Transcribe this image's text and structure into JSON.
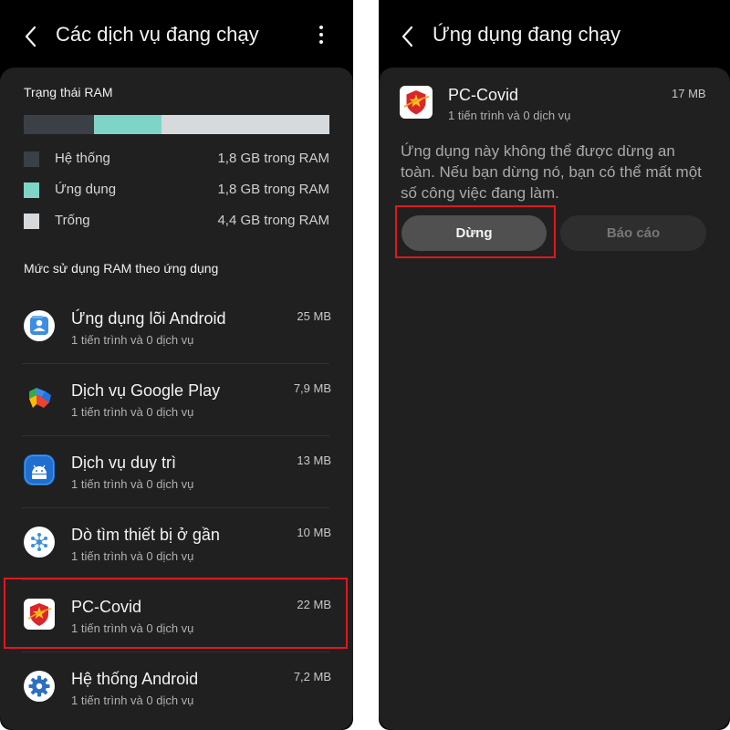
{
  "left": {
    "title": "Các dịch vụ đang chạy",
    "ram_section_title": "Trạng thái RAM",
    "ram_bar": [
      {
        "key": "system",
        "fraction": 0.23,
        "color": "#3b4046"
      },
      {
        "key": "apps",
        "fraction": 0.22,
        "color": "#7fd4c8"
      },
      {
        "key": "free",
        "fraction": 0.55,
        "color": "#d6dadd"
      }
    ],
    "legend": [
      {
        "label": "Hệ thống",
        "value": "1,8 GB trong RAM",
        "color": "#3b4046"
      },
      {
        "label": "Ứng dụng",
        "value": "1,8 GB trong RAM",
        "color": "#7fd4c8"
      },
      {
        "label": "Trống",
        "value": "4,4 GB trong RAM",
        "color": "#d6dadd"
      }
    ],
    "usage_title": "Mức sử dụng RAM theo ứng dụng",
    "apps": [
      {
        "name": "Ứng dụng lõi Android",
        "sub": "1 tiến trình và 0 dịch vụ",
        "size": "25 MB",
        "icon": "android-core-icon"
      },
      {
        "name": "Dịch vụ Google Play",
        "sub": "1 tiến trình và 0 dịch vụ",
        "size": "7,9 MB",
        "icon": "google-play-services-icon"
      },
      {
        "name": "Dịch vụ duy trì",
        "sub": "1 tiến trình và 0 dịch vụ",
        "size": "13 MB",
        "icon": "android-robot-icon"
      },
      {
        "name": "Dò tìm thiết bị ở gần",
        "sub": "1 tiến trình và 0 dịch vụ",
        "size": "10 MB",
        "icon": "nearby-devices-icon"
      },
      {
        "name": "PC-Covid",
        "sub": "1 tiến trình và 0 dịch vụ",
        "size": "22 MB",
        "icon": "pc-covid-icon"
      },
      {
        "name": "Hệ thống Android",
        "sub": "1 tiến trình và 0 dịch vụ",
        "size": "7,2 MB",
        "icon": "gear-icon"
      }
    ]
  },
  "right": {
    "title": "Ứng dụng đang chạy",
    "app_name": "PC-Covid",
    "app_sub": "1 tiến trình và 0 dịch vụ",
    "app_size": "17 MB",
    "message": "Ứng dụng này không thể được dừng an toàn. Nếu bạn dừng nó, bạn có thể mất một số công việc đang làm.",
    "stop_label": "Dừng",
    "report_label": "Báo cáo"
  },
  "colors": {
    "highlight": "#e0181c",
    "panel": "#202020",
    "background": "#000000"
  }
}
